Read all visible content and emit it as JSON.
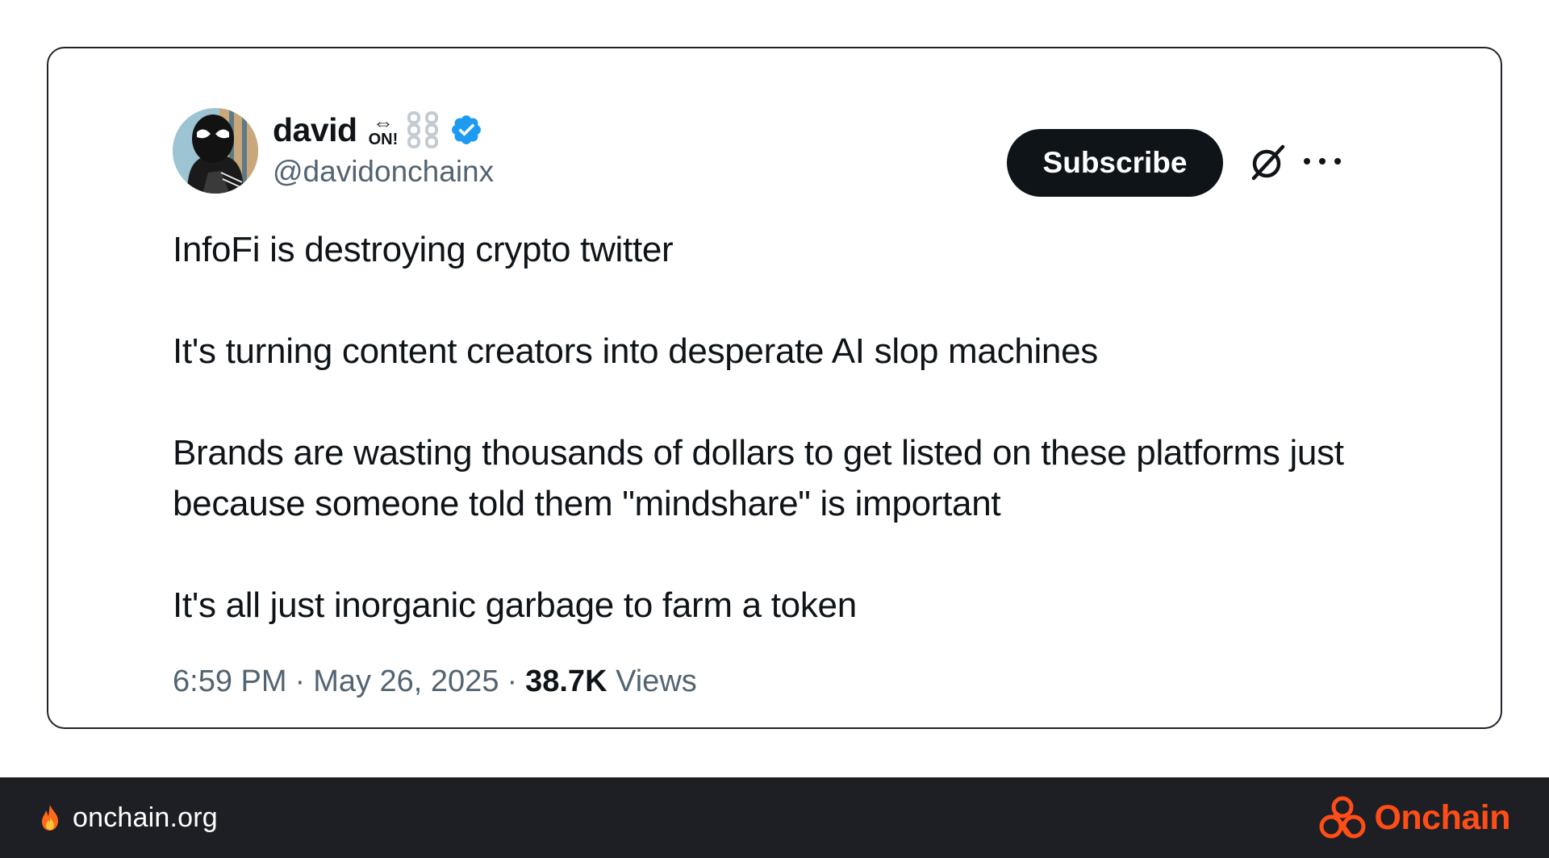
{
  "tweet": {
    "author": {
      "display_name": "david",
      "name_badge_text": "ON!",
      "handle": "@davidonchainx",
      "verified": true,
      "avatar_icon": "spider-man-avatar"
    },
    "actions": {
      "subscribe_label": "Subscribe",
      "grok_icon": "grok-slash-icon",
      "more_icon": "more-dots-icon"
    },
    "body": {
      "paragraphs": [
        "InfoFi is destroying crypto twitter",
        "It's turning content creators into desperate AI slop machines",
        "Brands are wasting thousands of dollars to get listed on these platforms just because someone told them \"mindshare\" is important",
        "It's all just inorganic garbage to farm a token"
      ]
    },
    "meta": {
      "time": "6:59 PM",
      "separator": "·",
      "date": "May 26, 2025",
      "views_count": "38.7K",
      "views_label": "Views"
    }
  },
  "footer": {
    "site_icon": "fire-icon",
    "site_url": "onchain.org",
    "brand_name": "Onchain",
    "brand_color": "#ff4d17"
  },
  "colors": {
    "text_primary": "#0f1419",
    "text_secondary": "#536471",
    "verified_blue": "#1d9bf0",
    "footer_bg": "#1e1f24"
  }
}
